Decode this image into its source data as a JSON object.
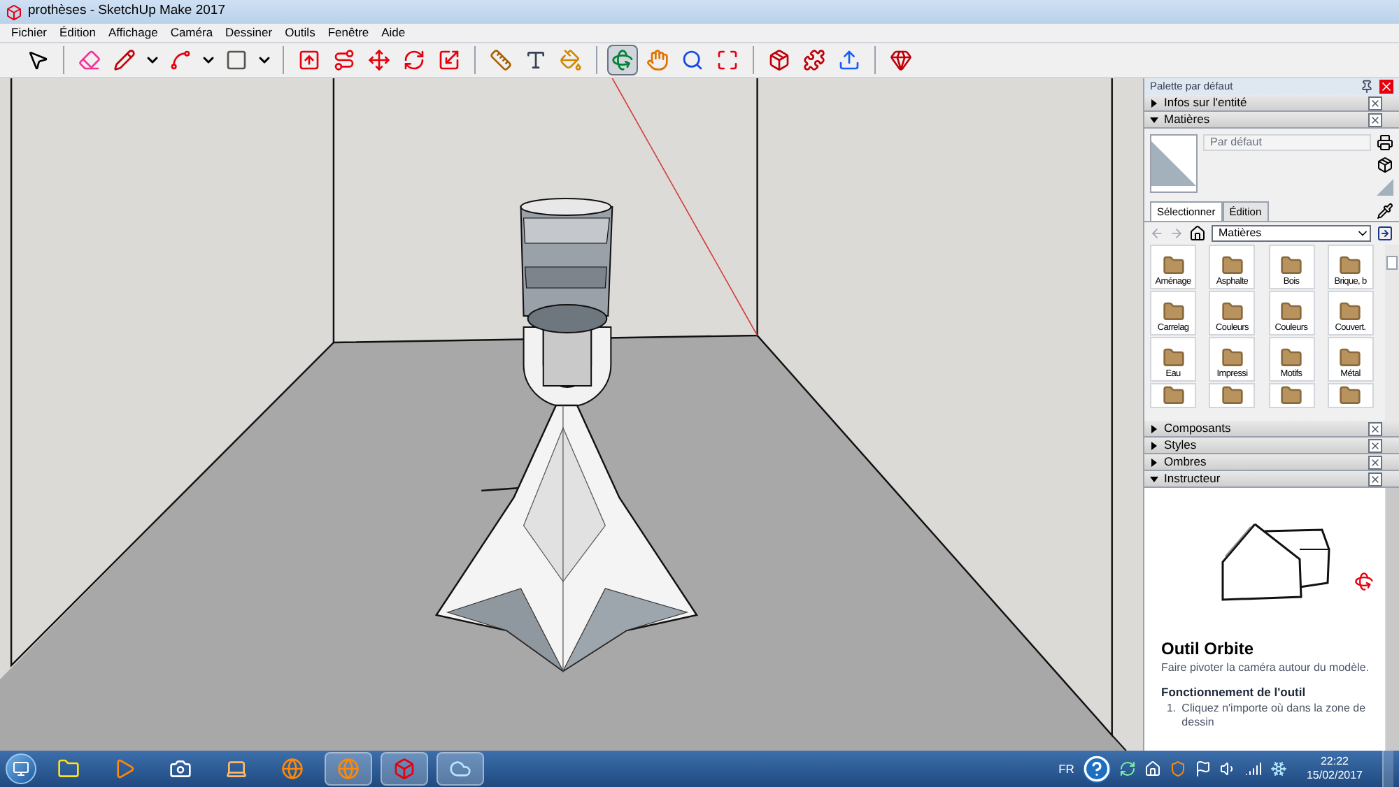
{
  "window": {
    "title": "prothèses - SketchUp Make 2017"
  },
  "menu": [
    {
      "label": "Fichier"
    },
    {
      "label": "Édition"
    },
    {
      "label": "Affichage"
    },
    {
      "label": "Caméra"
    },
    {
      "label": "Dessiner"
    },
    {
      "label": "Outils"
    },
    {
      "label": "Fenêtre"
    },
    {
      "label": "Aide"
    }
  ],
  "tools": [
    {
      "kind": "select",
      "selected": false
    },
    {
      "kind": "separator"
    },
    {
      "kind": "eraser",
      "selected": false
    },
    {
      "kind": "pencil",
      "selected": false
    },
    {
      "kind": "caret"
    },
    {
      "kind": "arc",
      "selected": false
    },
    {
      "kind": "caret"
    },
    {
      "kind": "rectangle",
      "selected": false
    },
    {
      "kind": "caret"
    },
    {
      "kind": "separator"
    },
    {
      "kind": "pushpull",
      "selected": false
    },
    {
      "kind": "followme",
      "selected": false
    },
    {
      "kind": "move",
      "selected": false
    },
    {
      "kind": "rotate",
      "selected": false
    },
    {
      "kind": "scale",
      "selected": false
    },
    {
      "kind": "separator"
    },
    {
      "kind": "tape",
      "selected": false
    },
    {
      "kind": "text",
      "selected": false
    },
    {
      "kind": "paint",
      "selected": false
    },
    {
      "kind": "separator"
    },
    {
      "kind": "orbit",
      "selected": true
    },
    {
      "kind": "pan",
      "selected": false
    },
    {
      "kind": "zoom",
      "selected": false
    },
    {
      "kind": "extents",
      "selected": false
    },
    {
      "kind": "separator"
    },
    {
      "kind": "warehouse",
      "selected": false
    },
    {
      "kind": "extensions",
      "selected": false
    },
    {
      "kind": "upload",
      "selected": false
    },
    {
      "kind": "separator"
    },
    {
      "kind": "ruby",
      "selected": false
    }
  ],
  "panel": {
    "title": "Palette par défaut",
    "sections": [
      {
        "label": "Infos sur l'entité",
        "expanded": false
      },
      {
        "kind": "materials",
        "label": "Matières",
        "expanded": true
      },
      {
        "label": "Composants",
        "expanded": false
      },
      {
        "label": "Styles",
        "expanded": false
      },
      {
        "label": "Ombres",
        "expanded": false
      },
      {
        "kind": "instructor",
        "label": "Instructeur",
        "expanded": true
      }
    ]
  },
  "materials": {
    "placeholder": "Par défaut",
    "tabs": [
      {
        "label": "Sélectionner",
        "selected": true
      },
      {
        "label": "Édition",
        "selected": false
      }
    ],
    "collection": "Matières",
    "items": [
      {
        "label": "Aménage"
      },
      {
        "label": "Asphalte"
      },
      {
        "label": "Bois"
      },
      {
        "label": "Brique, b"
      },
      {
        "label": "Carrelag"
      },
      {
        "label": "Couleurs"
      },
      {
        "label": "Couleurs"
      },
      {
        "label": "Couvert."
      },
      {
        "label": "Eau"
      },
      {
        "label": "Impressi"
      },
      {
        "label": "Motifs"
      },
      {
        "label": "Métal"
      }
    ]
  },
  "instructor": {
    "title": "Outil Orbite",
    "description": "Faire pivoter la caméra autour du modèle.",
    "heading": "Fonctionnement de l'outil",
    "steps": [
      {
        "number": "1.",
        "text": "Cliquez n'importe où dans la zone de dessin"
      }
    ]
  },
  "taskbar": {
    "apps": [
      {
        "kind": "explorer",
        "active": false
      },
      {
        "kind": "media",
        "active": false
      },
      {
        "kind": "camera",
        "active": false
      },
      {
        "kind": "laptop",
        "active": false
      },
      {
        "kind": "browser",
        "active": false
      },
      {
        "kind": "browser",
        "active": true
      },
      {
        "kind": "sketchup",
        "active": true
      },
      {
        "kind": "cloud",
        "active": true
      }
    ],
    "language": "FR",
    "time": "22:22",
    "date": "15/02/2017"
  }
}
